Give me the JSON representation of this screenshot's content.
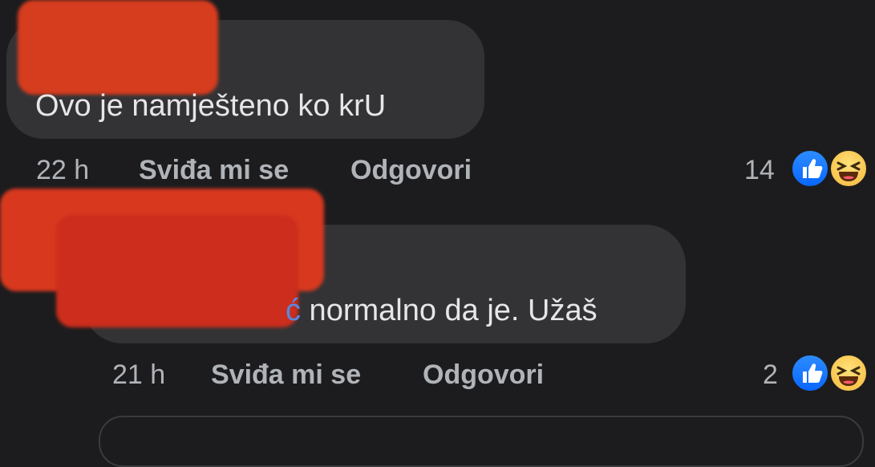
{
  "comments": [
    {
      "text": "Ovo je namješteno ko krU",
      "time": "22 h",
      "like_label": "Sviđa mi se",
      "reply_label": "Odgovori",
      "reaction_count": "14",
      "reactions": [
        "like-icon",
        "haha-icon"
      ]
    },
    {
      "text_accent": "ć",
      "text": " normalno da je. Užaš",
      "time": "21 h",
      "like_label": "Sviđa mi se",
      "reply_label": "Odgovori",
      "reaction_count": "2",
      "reactions": [
        "like-icon",
        "haha-icon"
      ]
    }
  ],
  "colors": {
    "background": "#1c1c1e",
    "bubble": "#333335",
    "redaction": "#d63c1e",
    "like": "#0866ff"
  }
}
